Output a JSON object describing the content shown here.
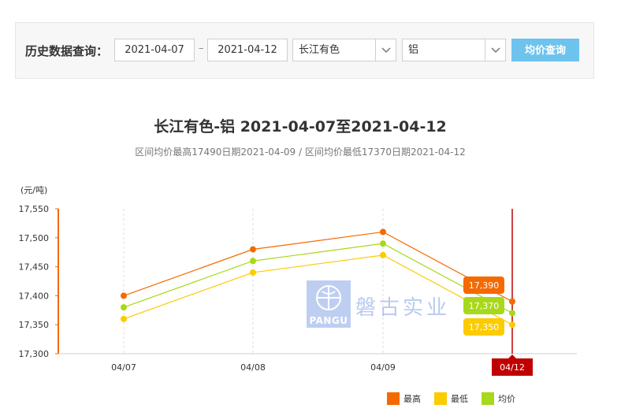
{
  "query": {
    "label": "历史数据查询：",
    "start_date": "2021-04-07",
    "end_date": "2021-04-12",
    "separator": "–",
    "market": "长江有色",
    "metal": "铝",
    "button": "均价查询"
  },
  "watermark": {
    "logo_text": "PANGU",
    "company": "磐古实业"
  },
  "chart_data": {
    "type": "line",
    "title": "长江有色-铝 2021-04-07至2021-04-12",
    "subtitle": "区间均价最高17490日期2021-04-09 / 区间均价最低17370日期2021-04-12",
    "ylabel": "(元/吨)",
    "categories": [
      "04/07",
      "04/08",
      "04/09",
      "04/12"
    ],
    "ylim": [
      17300,
      17550
    ],
    "yticks": [
      "17,300",
      "17,350",
      "17,400",
      "17,450",
      "17,500",
      "17,550"
    ],
    "series": [
      {
        "name": "最高",
        "color": "#f56a00",
        "values": [
          17400,
          17480,
          17510,
          17390
        ]
      },
      {
        "name": "最低",
        "color": "#fccb00",
        "values": [
          17360,
          17440,
          17470,
          17350
        ]
      },
      {
        "name": "均价",
        "color": "#a8d81a",
        "values": [
          17380,
          17460,
          17490,
          17370
        ]
      }
    ],
    "tooltip": {
      "category": "04/12",
      "labels": [
        "17,390",
        "17,370",
        "17,350"
      ],
      "colors": [
        "#f56a00",
        "#a8d81a",
        "#fccb00"
      ]
    },
    "crosshair_color": "#c00000",
    "legend_position": "bottom-right",
    "grid": "vertical-dashed"
  }
}
